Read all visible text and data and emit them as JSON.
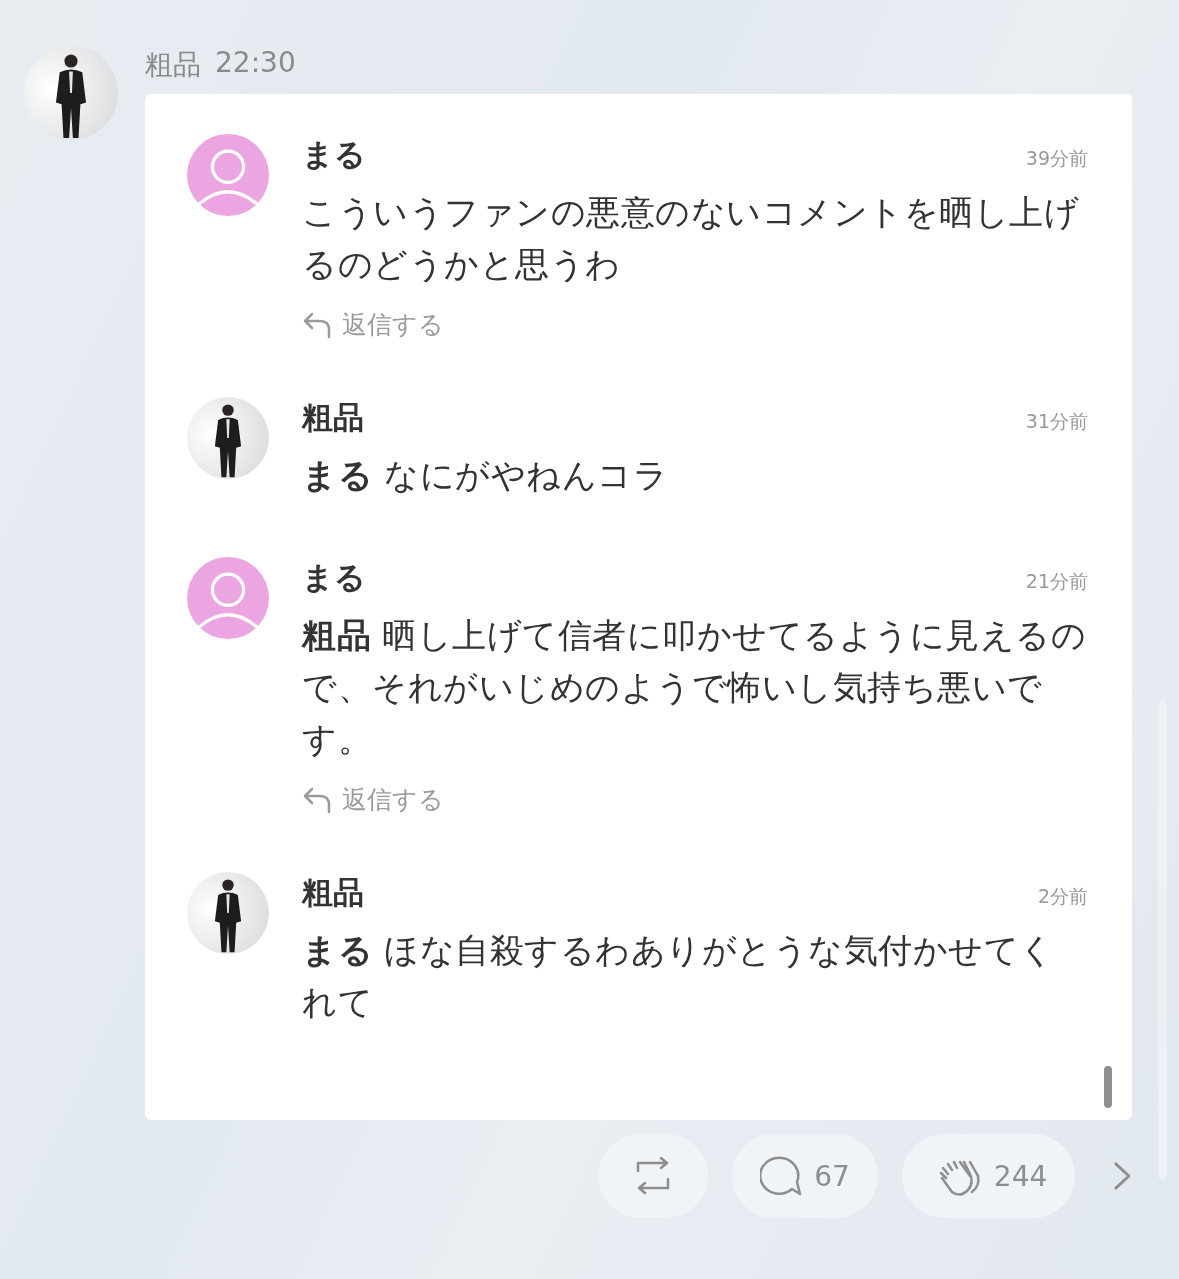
{
  "post": {
    "author": "粗品",
    "time": "22:30"
  },
  "comments": [
    {
      "author": "まる",
      "kind": "default_avatar",
      "time": "39分前",
      "text": "こういうファンの悪意のないコメントを晒し上げるのどうかと思うわ",
      "reply_label": "返信する"
    },
    {
      "author": "粗品",
      "kind": "photo_avatar",
      "time": "31分前",
      "text": "**まる** なにがやねんコラ"
    },
    {
      "author": "まる",
      "kind": "default_avatar",
      "time": "21分前",
      "text": "**粗品** 晒し上げて信者に叩かせてるように見えるので、それがいじめのようで怖いし気持ち悪いです。",
      "reply_label": "返信する"
    },
    {
      "author": "粗品",
      "kind": "photo_avatar",
      "time": "2分前",
      "text": "**まる** ほな自殺するわありがとうな気付かせてくれて"
    }
  ],
  "actions": [
    {
      "kind": "repost"
    },
    {
      "kind": "comment",
      "count": "67"
    },
    {
      "kind": "clap",
      "count": "244"
    }
  ]
}
